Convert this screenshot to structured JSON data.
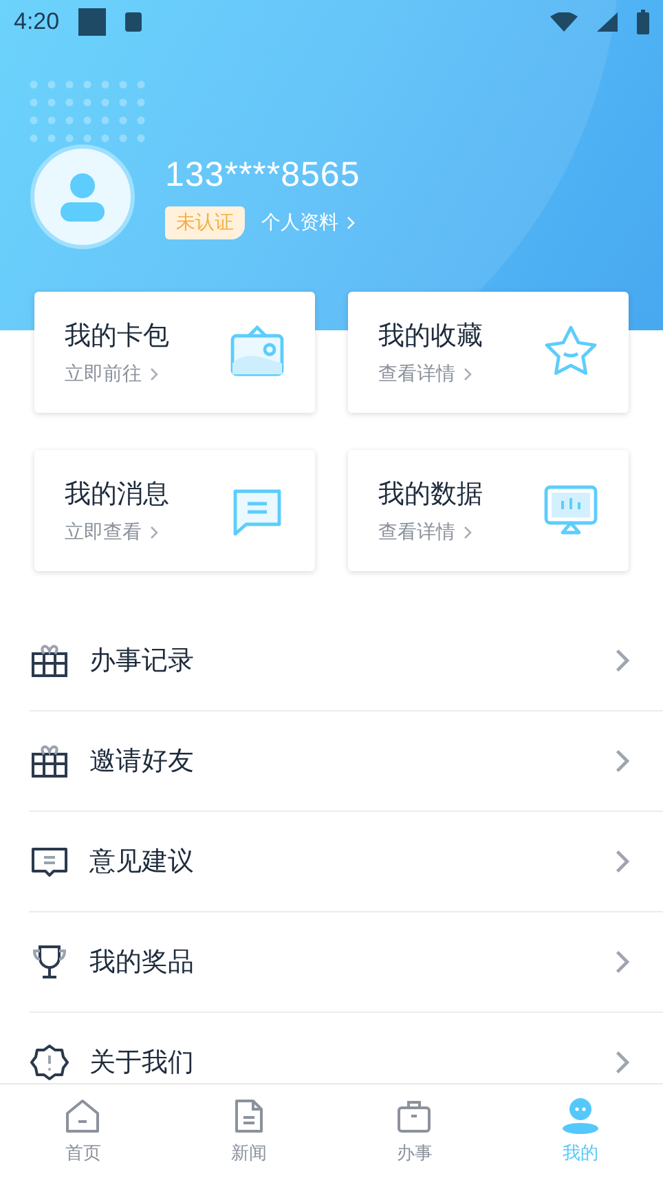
{
  "status_bar": {
    "time": "4:20"
  },
  "profile": {
    "phone": "133****8565",
    "verification_badge": "未认证",
    "profile_link": "个人资料"
  },
  "cards": [
    {
      "kind": "wallet",
      "title": "我的卡包",
      "subtitle": "立即前往"
    },
    {
      "kind": "star",
      "title": "我的收藏",
      "subtitle": "查看详情"
    },
    {
      "kind": "message",
      "title": "我的消息",
      "subtitle": "立即查看"
    },
    {
      "kind": "monitor",
      "title": "我的数据",
      "subtitle": "查看详情"
    }
  ],
  "menu": [
    {
      "kind": "gift",
      "label": "办事记录"
    },
    {
      "kind": "gift",
      "label": "邀请好友"
    },
    {
      "kind": "comment",
      "label": "意见建议"
    },
    {
      "kind": "trophy",
      "label": "我的奖品"
    },
    {
      "kind": "alert",
      "label": "关于我们"
    }
  ],
  "tab_bar": [
    {
      "kind": "home",
      "label": "首页",
      "selected": false
    },
    {
      "kind": "document",
      "label": "新闻",
      "selected": false
    },
    {
      "kind": "briefcase",
      "label": "办事",
      "selected": false
    },
    {
      "kind": "person",
      "label": "我的",
      "selected": true
    }
  ]
}
